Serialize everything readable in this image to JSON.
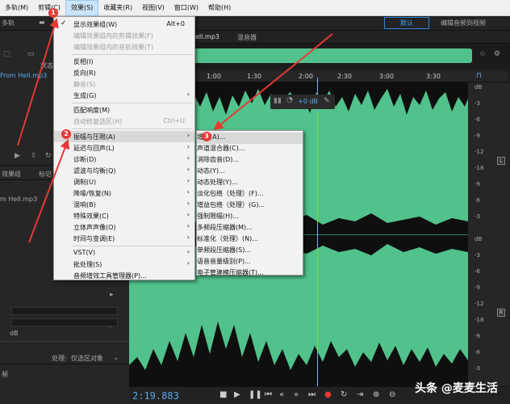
{
  "menubar": {
    "items": [
      "多轨(M)",
      "剪辑(C)",
      "效果(S)",
      "收藏夹(R)",
      "视图(V)",
      "窗口(W)",
      "帮助(H)"
    ]
  },
  "toolbar": {
    "left_label": "多轨",
    "workspace_default": "默认",
    "workspace_edit": "编辑音频到视频"
  },
  "left_panel": {
    "file_name": "From Hell.mp3",
    "status_label": "状态",
    "tab_effects": "效果组",
    "tab_markers": "标记",
    "effects_file": "m Hell.mp3",
    "meter_db": "dB",
    "process_label": "处理:",
    "process_value": "仅选区对象",
    "bottom_label": "频"
  },
  "editor": {
    "file_tab": "ell.mp3",
    "mixer_tab": "混音器",
    "ruler": [
      "1:00",
      "1:30",
      "2:00",
      "2:30",
      "3:00",
      "3:30"
    ],
    "db_scale_top": [
      "dB",
      "-3",
      "-6",
      "-9",
      "-12",
      "-18",
      "-9",
      "-6",
      "-3"
    ],
    "db_scale_bottom": [
      "dB",
      "-3",
      "-6",
      "-9",
      "-12",
      "-18",
      "-9",
      "-6",
      "-3"
    ],
    "channel_left": "L",
    "channel_right": "R",
    "hud_value": "+0 dB"
  },
  "transport": {
    "timecode": "2:19.883",
    "watermark": "头条 @麦麦生活"
  },
  "effect_menu": {
    "items": [
      {
        "label": "显示效果组(W)",
        "shortcut": "Alt+0",
        "checked": true,
        "disabled": false,
        "sub": false
      },
      {
        "label": "编辑效果组内的剪辑效果(F)",
        "shortcut": "",
        "checked": false,
        "disabled": true,
        "sub": false
      },
      {
        "label": "编辑效果组内的音轨效果(T)",
        "shortcut": "",
        "checked": false,
        "disabled": true,
        "sub": false
      },
      {
        "label": "反相(I)",
        "shortcut": "",
        "checked": false,
        "disabled": false,
        "sub": false
      },
      {
        "label": "反向(R)",
        "shortcut": "",
        "checked": false,
        "disabled": false,
        "sub": false
      },
      {
        "label": "静音(S)",
        "shortcut": "",
        "checked": false,
        "disabled": true,
        "sub": false
      },
      {
        "label": "生成(G)",
        "shortcut": "",
        "checked": false,
        "disabled": false,
        "sub": true
      },
      {
        "label": "匹配响度(M)",
        "shortcut": "",
        "checked": false,
        "disabled": false,
        "sub": false
      },
      {
        "label": "自动修复选区(H)",
        "shortcut": "Ctrl+U",
        "checked": false,
        "disabled": true,
        "sub": false
      },
      {
        "label": "振幅与压限(A)",
        "shortcut": "",
        "checked": false,
        "disabled": false,
        "sub": true
      },
      {
        "label": "延迟与回声(L)",
        "shortcut": "",
        "checked": false,
        "disabled": false,
        "sub": true
      },
      {
        "label": "诊断(D)",
        "shortcut": "",
        "checked": false,
        "disabled": false,
        "sub": true
      },
      {
        "label": "滤波与均衡(Q)",
        "shortcut": "",
        "checked": false,
        "disabled": false,
        "sub": true
      },
      {
        "label": "调制(U)",
        "shortcut": "",
        "checked": false,
        "disabled": false,
        "sub": true
      },
      {
        "label": "降噪/恢复(N)",
        "shortcut": "",
        "checked": false,
        "disabled": false,
        "sub": true
      },
      {
        "label": "混响(B)",
        "shortcut": "",
        "checked": false,
        "disabled": false,
        "sub": true
      },
      {
        "label": "特殊效果(C)",
        "shortcut": "",
        "checked": false,
        "disabled": false,
        "sub": true
      },
      {
        "label": "立体声声像(O)",
        "shortcut": "",
        "checked": false,
        "disabled": false,
        "sub": true
      },
      {
        "label": "时间与变调(E)",
        "shortcut": "",
        "checked": false,
        "disabled": false,
        "sub": true
      },
      {
        "label": "VST(V)",
        "shortcut": "",
        "checked": false,
        "disabled": false,
        "sub": true
      },
      {
        "label": "批处理(S)",
        "shortcut": "",
        "checked": false,
        "disabled": false,
        "sub": true
      },
      {
        "label": "音频增效工具管理器(P)...",
        "shortcut": "",
        "checked": false,
        "disabled": false,
        "sub": false
      }
    ]
  },
  "sub_menu": {
    "items": [
      "增幅(A)...",
      "声道混合器(C)...",
      "消除齿音(D)...",
      "动态(Y)...",
      "动态处理(Y)...",
      "淡化包络（处理）(F)...",
      "增益包络（处理）(G)...",
      "强制限幅(H)...",
      "多频段压缩器(M)...",
      "标准化（处理）(N)...",
      "单频段压缩器(S)...",
      "语音音量级别(P)...",
      "电子管建模压缩器(T)..."
    ]
  },
  "badges": [
    "1",
    "2",
    "3"
  ]
}
